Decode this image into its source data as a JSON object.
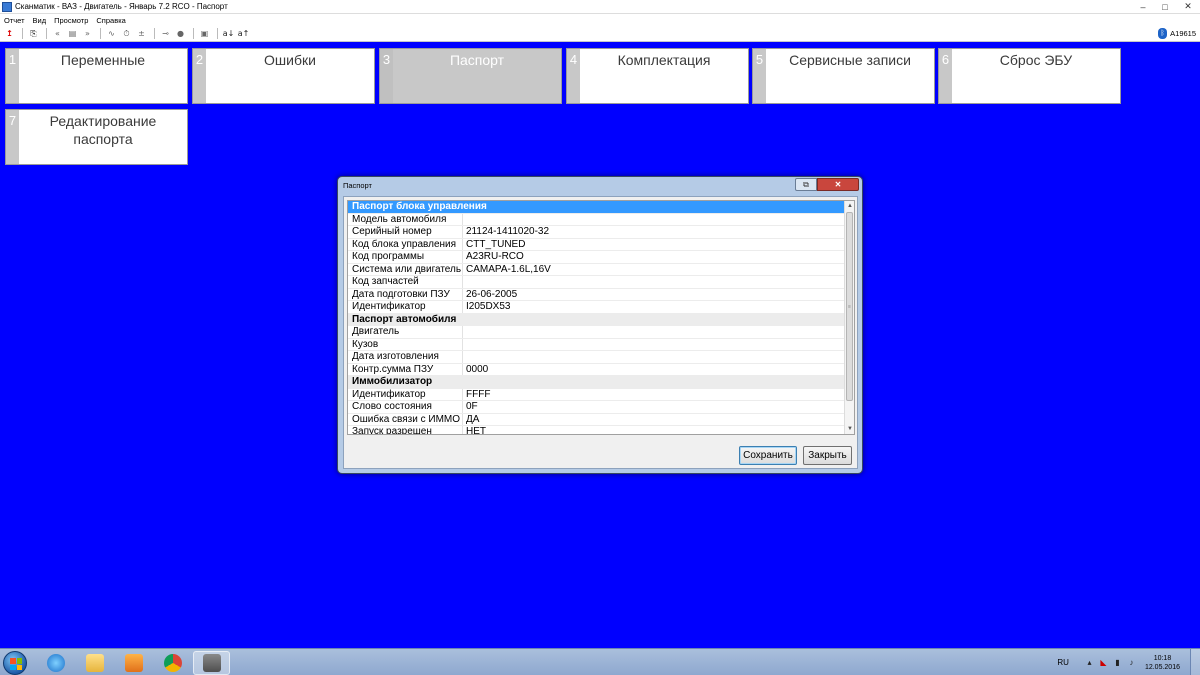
{
  "window": {
    "title": "Сканматик - ВАЗ - Двигатель - Январь 7.2 RCO - Паспорт",
    "minimize": "–",
    "maximize": "□",
    "close": "✕"
  },
  "menu": [
    "Отчет",
    "Вид",
    "Просмотр",
    "Справка"
  ],
  "toolbar": {
    "icons": [
      "arrow-up-icon",
      "save-icon",
      "rewind-icon",
      "pause-icon",
      "forward-icon",
      "wave-icon",
      "time-icon",
      "ms-icon",
      "plug-icon",
      "record-icon",
      "save-disk-icon",
      "sort-az-icon",
      "sort-za-icon"
    ],
    "device_id": "A19615"
  },
  "tiles": [
    {
      "num": "1",
      "label": "Переменные"
    },
    {
      "num": "2",
      "label": "Ошибки"
    },
    {
      "num": "3",
      "label": "Паспорт"
    },
    {
      "num": "4",
      "label": "Комплектация"
    },
    {
      "num": "5",
      "label": "Сервисные записи"
    },
    {
      "num": "6",
      "label": "Сброс ЭБУ"
    },
    {
      "num": "7",
      "label": "Редактирование паспорта"
    }
  ],
  "dialog": {
    "title": "Паспорт",
    "sections": [
      {
        "header": "Паспорт блока управления",
        "rows": [
          {
            "key": "Модель автомобиля",
            "value": ""
          },
          {
            "key": "Серийный номер",
            "value": "21124-1411020-32"
          },
          {
            "key": "Код блока управления",
            "value": "CTT_TUNED"
          },
          {
            "key": "Код программы",
            "value": "A23RU-RCO"
          },
          {
            "key": "Система или двигатель",
            "value": "CAMAPA-1.6L,16V"
          },
          {
            "key": "Код запчастей",
            "value": ""
          },
          {
            "key": "Дата подготовки ПЗУ",
            "value": "26-06-2005"
          },
          {
            "key": "Идентификатор",
            "value": "I205DX53"
          }
        ]
      },
      {
        "header": "Паспорт автомобиля",
        "rows": [
          {
            "key": "Двигатель",
            "value": ""
          },
          {
            "key": "Кузов",
            "value": ""
          },
          {
            "key": "Дата изготовления",
            "value": ""
          },
          {
            "key": "Контр.сумма ПЗУ",
            "value": "0000"
          }
        ]
      },
      {
        "header": "Иммобилизатор",
        "rows": [
          {
            "key": "Идентификатор",
            "value": "FFFF"
          },
          {
            "key": "Слово состояния",
            "value": "0F"
          },
          {
            "key": "Ошибка связи с ИММО",
            "value": "ДА"
          },
          {
            "key": "Запуск разрешен",
            "value": "НЕТ"
          }
        ]
      }
    ],
    "save_label": "Сохранить",
    "close_label": "Закрыть"
  },
  "taskbar": {
    "lang": "RU",
    "time": "10:18",
    "date": "12.05.2016"
  },
  "colors": {
    "desktop": "#0000ff",
    "tile": "#ffffff",
    "tile_active": "#c8c8c8",
    "selection": "#3399ff"
  }
}
